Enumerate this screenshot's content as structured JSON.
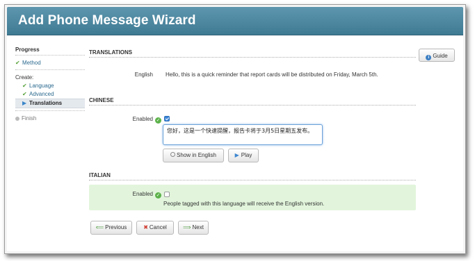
{
  "window": {
    "title": "Add Phone Message Wizard"
  },
  "sidebar": {
    "progress_label": "Progress",
    "method_label": "Method",
    "create_label": "Create:",
    "language_label": "Language",
    "advanced_label": "Advanced",
    "translations_label": "Translations",
    "finish_label": "Finish"
  },
  "guide_button": {
    "label": "Guide"
  },
  "translations": {
    "section_title": "TRANSLATIONS",
    "language": "English",
    "message": "Hello, this is a quick reminder that report cards will be distributed on Friday, March 5th."
  },
  "chinese": {
    "section_title": "CHINESE",
    "enabled_label": "Enabled",
    "enabled": true,
    "text": "您好，这是一个快速提醒，报告卡将于3月5日星期五发布。",
    "show_button": "Show in English",
    "play_button": "Play"
  },
  "italian": {
    "section_title": "ITALIAN",
    "enabled_label": "Enabled",
    "enabled": false,
    "note": "People tagged with this language will receive the English version."
  },
  "footer": {
    "previous": "Previous",
    "cancel": "Cancel",
    "next": "Next"
  },
  "colors": {
    "titlebar": "#4a86a0",
    "green_box": "#e2f5dc",
    "link": "#2b6a8f",
    "check": "#57a23b"
  }
}
